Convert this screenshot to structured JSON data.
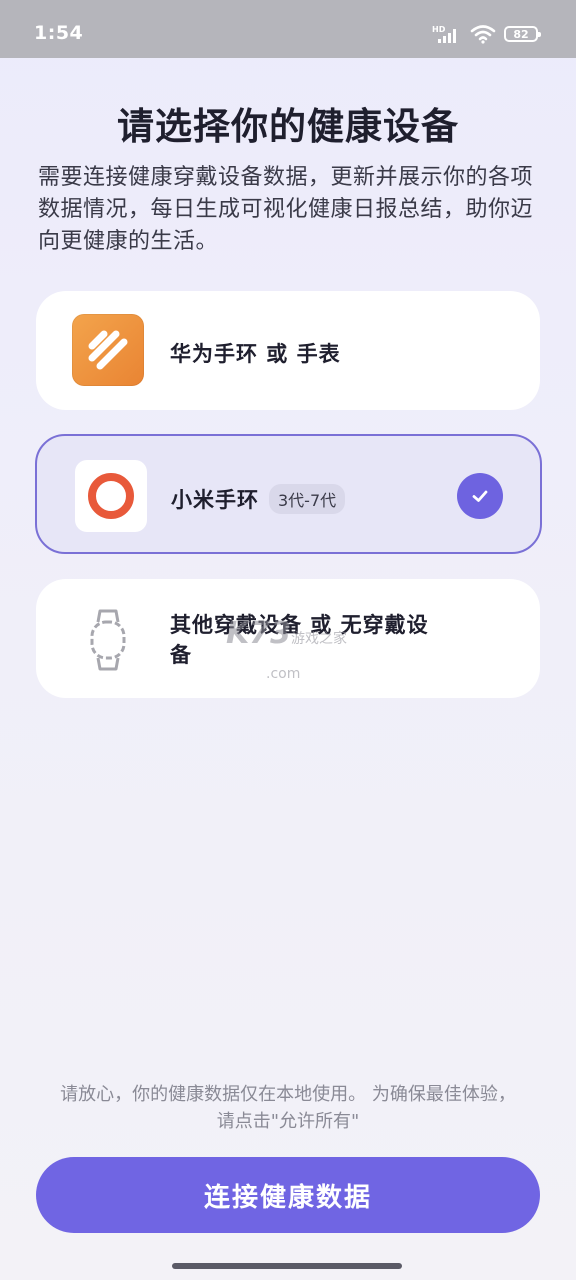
{
  "status_bar": {
    "time": "1:54",
    "battery": "82",
    "icons": [
      "hd-signal-icon",
      "wifi-icon",
      "battery-icon"
    ]
  },
  "title": "请选择你的健康设备",
  "description": "需要连接健康穿戴设备数据，更新并展示你的各项数据情况，每日生成可视化健康日报总结，助你迈向更健康的生活。",
  "devices": [
    {
      "label": "华为手环 或 手表",
      "icon": "huawei-health-icon",
      "selected": false
    },
    {
      "label": "小米手环",
      "badge": "3代-7代",
      "icon": "mi-band-ring-icon",
      "selected": true
    },
    {
      "label": "其他穿戴设备 或 无穿戴设备",
      "icon": "smartwatch-outline-icon",
      "selected": false
    }
  ],
  "watermark": {
    "main": "K73",
    "sub": "游戏之家",
    "domain": ".com"
  },
  "note_line1": "请放心，你的健康数据仅在本地使用。 为确保最佳体验，",
  "note_line2": "请点击\"允许所有\"",
  "connect_button": "连接健康数据",
  "colors": {
    "accent": "#7065e3",
    "selected_border": "#7a70d6",
    "selected_bg": "#e7e6f7",
    "huawei_orange": "#ee8f3a",
    "mi_red": "#e8593a"
  }
}
